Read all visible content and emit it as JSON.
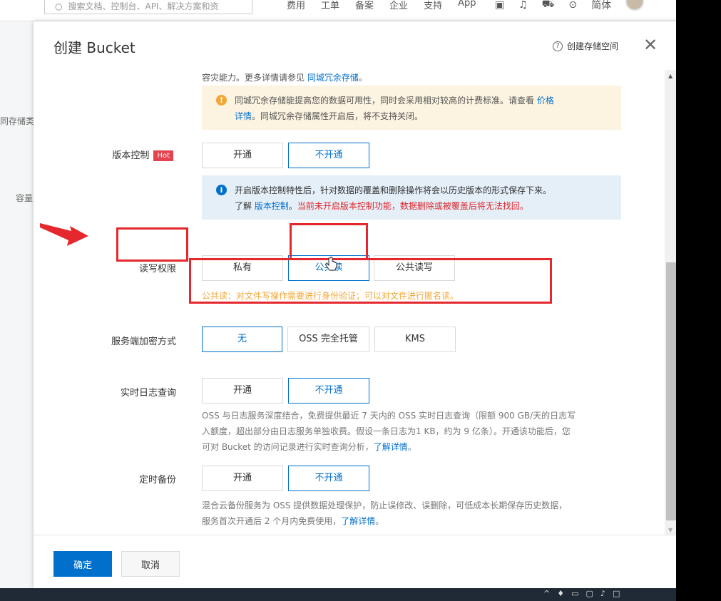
{
  "background": {
    "search_placeholder": "搜索文档、控制台、API、解决方案和资",
    "nav_items": [
      "费用",
      "工单",
      "备案",
      "企业",
      "支持",
      "App"
    ],
    "language_label": "简体",
    "left_items": [
      "同存储类型",
      "容量"
    ]
  },
  "modal": {
    "title": "创建 Bucket",
    "help_icon": "?",
    "help_link": "创建存储空间",
    "close_icon": "✕"
  },
  "redundancy": {
    "desc_prefix": "容灾能力。更多详情请参见",
    "desc_link": "同城冗余存储",
    "desc_suffix": "。",
    "alert_icon": "!",
    "alert_line1": "同城冗余存储能提高您的数据可用性，同时会采用相对较高的计费标准。请查看",
    "alert_link_1": "价格",
    "alert_link_2": "详情",
    "alert_line2": "。同城冗余存储属性开启后，将不支持关闭。"
  },
  "versioning": {
    "label": "版本控制",
    "hot_badge": "Hot",
    "options": [
      "开通",
      "不开通"
    ],
    "selected": "不开通",
    "alert_icon": "i",
    "alert_line1": "开启版本控制特性后，针对数据的覆盖和删除操作将会以历史版本的形式保存下来。",
    "alert_prefix": "了解",
    "alert_link": "版本控制",
    "alert_sep": "。",
    "alert_warning": "当前未开启版本控制功能，数据删除或被覆盖后将无法找回。"
  },
  "acl": {
    "label": "读写权限",
    "options": [
      "私有",
      "公共读",
      "公共读写"
    ],
    "selected": "公共读",
    "hint": "公共读：对文件写操作需要进行身份验证；可以对文件进行匿名读。"
  },
  "encryption": {
    "label": "服务端加密方式",
    "options": [
      "无",
      "OSS 完全托管",
      "KMS"
    ],
    "selected": "无"
  },
  "realtime_log": {
    "label": "实时日志查询",
    "options": [
      "开通",
      "不开通"
    ],
    "selected": "不开通",
    "desc_line1": "OSS 与日志服务深度结合，免费提供最近 7 天内的 OSS 实时日志查询（限额 900 GB/天的日志写",
    "desc_line2": "入额度，超出部分由日志服务单独收费。假设一条日志为1 KB，约为 9 亿条）。开通该功能后，您",
    "desc_line3_prefix": "可对 Bucket 的访问记录进行实时查询分析，",
    "desc_link": "了解详情",
    "desc_end": "。"
  },
  "backup": {
    "label": "定时备份",
    "options": [
      "开通",
      "不开通"
    ],
    "selected": "不开通",
    "desc_line1": "混合云备份服务为 OSS 提供数据处理保护，防止误修改、误删除，可低成本长期保存历史数据，",
    "desc_line2_prefix": "服务首次开通后 2 个月内免费使用，",
    "desc_link": "了解详情",
    "desc_end": "。"
  },
  "footer": {
    "confirm": "确定",
    "cancel": "取消"
  },
  "colors": {
    "primary": "#0070cc",
    "annotation_red": "#e5282d",
    "hint_orange": "#f3a634"
  }
}
